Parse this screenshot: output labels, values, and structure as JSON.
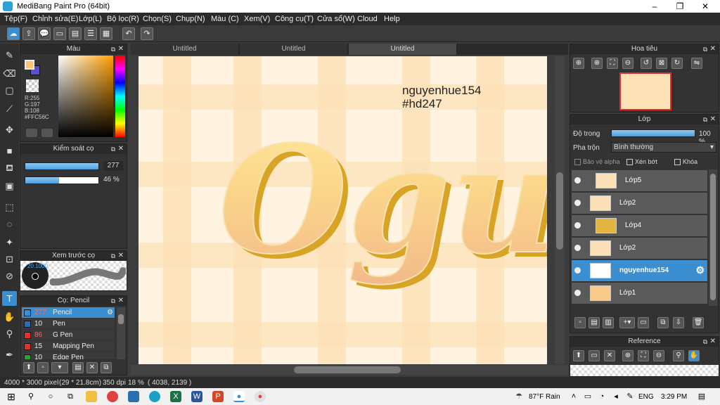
{
  "window": {
    "title": "MediBang Paint Pro (64bit)",
    "minimize": "–",
    "maximize": "❐",
    "close": "✕"
  },
  "menu": [
    "Tệp(F)",
    "Chỉnh sửa(E)",
    "Lớp(L)",
    "Bộ lọc(R)",
    "Chọn(S)",
    "Chụp(N)",
    "Màu (C)",
    "Xem(V)",
    "Công cụ(T)",
    "Cửa sổ(W)",
    "Cloud",
    "Help"
  ],
  "color_panel": {
    "title": "Màu",
    "r": "R:255",
    "g": "G:197",
    "b": "B:108",
    "hex": "#FFC56C",
    "fg": "#ffc56c",
    "bg": "#5a4fd0"
  },
  "brush_control": {
    "title": "Kiểm soát cọ",
    "size": "277",
    "opacity": "46 %",
    "size_fraction": 1.0,
    "opacity_fraction": 0.46
  },
  "brush_preview": {
    "title": "Xem trước cọ",
    "label": "20.1000"
  },
  "brush_list": {
    "title": "Cọ: Pencil",
    "items": [
      {
        "size": "277",
        "name": "Pencil",
        "color": "#3b8fd1",
        "selected": true
      },
      {
        "size": "10",
        "name": "Pen",
        "color": "#2a6fb0",
        "selected": false
      },
      {
        "size": "86",
        "name": "G Pen",
        "color": "#e03030",
        "selected": false
      },
      {
        "size": "15",
        "name": "Mapping Pen",
        "color": "#e03030",
        "selected": false
      },
      {
        "size": "10",
        "name": "Edge Pen",
        "color": "#30a030",
        "selected": false
      }
    ]
  },
  "tabs": [
    "Untitled",
    "Untitled",
    "Untitled"
  ],
  "canvas": {
    "line1": "nguyenhue154",
    "line2": "#hd247",
    "art_text": "Ogu"
  },
  "navigator": {
    "title": "Hoa tiêu"
  },
  "layer_panel": {
    "title": "Lớp",
    "opacity_label": "Độ trong",
    "opacity_value": "100 %",
    "opacity_fraction": 1.0,
    "blend_label": "Pha trộn",
    "blend_value": "Bình thường",
    "protect_alpha": "Bảo vệ alpha",
    "clipping": "Xén bớt",
    "lock": "Khóa",
    "layers": [
      {
        "name": "Lớp5",
        "selected": false,
        "indent": true
      },
      {
        "name": "Lớp2",
        "selected": false,
        "indent": false
      },
      {
        "name": "Lớp4",
        "selected": false,
        "indent": true
      },
      {
        "name": "Lớp2",
        "selected": false,
        "indent": false
      },
      {
        "name": "nguyenhue154",
        "selected": true,
        "indent": false
      },
      {
        "name": "Lớp1",
        "selected": false,
        "indent": false
      }
    ]
  },
  "reference": {
    "title": "Reference"
  },
  "status": {
    "size": "4000 * 3000 pixel",
    "cm": "(29 * 21.8cm)",
    "dpi": "350 dpi",
    "zoom": "18 %",
    "coords": "( 4038, 2139 )"
  },
  "taskbar": {
    "weather": "87°F  Rain",
    "lang": "ENG",
    "time": "3:29 PM"
  }
}
